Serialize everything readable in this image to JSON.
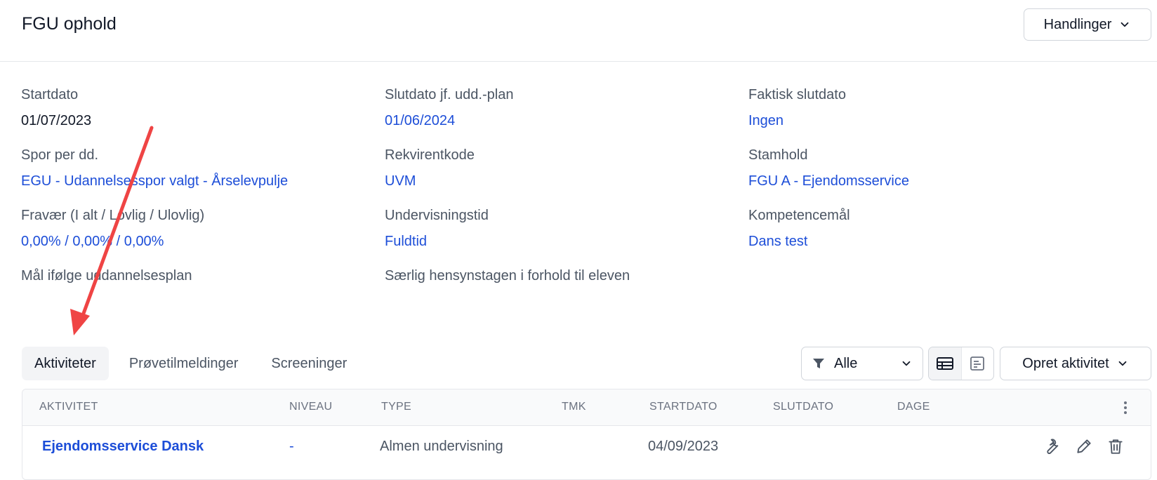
{
  "header": {
    "title": "FGU ophold",
    "actions_label": "Handlinger"
  },
  "details": {
    "startdato": {
      "label": "Startdato",
      "value": "01/07/2023"
    },
    "slutdato_plan": {
      "label": "Slutdato jf. udd.-plan",
      "value": "01/06/2024"
    },
    "faktisk_slutdato": {
      "label": "Faktisk slutdato",
      "value": "Ingen"
    },
    "spor": {
      "label": "Spor per dd.",
      "value": "EGU - Udannelsesspor valgt - Årselevpulje"
    },
    "rekvirentkode": {
      "label": "Rekvirentkode",
      "value": "UVM"
    },
    "stamhold": {
      "label": "Stamhold",
      "value": "FGU A - Ejendomsservice"
    },
    "fravaer": {
      "label": "Fravær (I alt / Lovlig / Ulovlig)",
      "value": "0,00% / 0,00% / 0,00%"
    },
    "undervisningstid": {
      "label": "Undervisningstid",
      "value": "Fuldtid"
    },
    "kompetencemaal": {
      "label": "Kompetencemål",
      "value": "Dans test"
    },
    "maal": {
      "label": "Mål ifølge uddannelsesplan"
    },
    "hensyn": {
      "label": "Særlig hensynstagen i forhold til eleven"
    }
  },
  "tabs": [
    {
      "label": "Aktiviteter",
      "active": true
    },
    {
      "label": "Prøvetilmeldinger",
      "active": false
    },
    {
      "label": "Screeninger",
      "active": false
    }
  ],
  "toolbar": {
    "filter_value": "Alle",
    "create_label": "Opret aktivitet"
  },
  "table": {
    "columns": [
      "AKTIVITET",
      "NIVEAU",
      "TYPE",
      "TMK",
      "STARTDATO",
      "SLUTDATO",
      "DAGE"
    ],
    "rows": [
      {
        "aktivitet": "Ejendomsservice Dansk",
        "niveau": "-",
        "type": "Almen undervisning",
        "tmk": "",
        "startdato": "04/09/2023",
        "slutdato": "",
        "dage": ""
      }
    ]
  },
  "colors": {
    "link": "#1d4ed8",
    "annotation_arrow": "#ef4444"
  }
}
